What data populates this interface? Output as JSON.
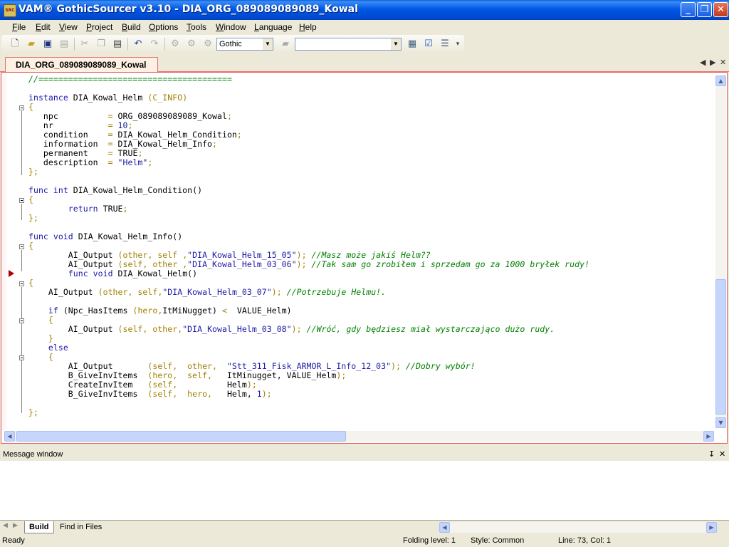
{
  "window": {
    "app_icon_text": "SRC",
    "title": "VAM® GothicSourcer v3.10 - DIA_ORG_089089089089_Kowal",
    "minimize_glyph": "_",
    "maximize_glyph": "❐",
    "close_glyph": "✕"
  },
  "menu": {
    "file": {
      "acc": "F",
      "rest": "ile"
    },
    "edit": {
      "acc": "E",
      "rest": "dit"
    },
    "view": {
      "acc": "V",
      "rest": "iew"
    },
    "project": {
      "acc": "P",
      "rest": "roject"
    },
    "build": {
      "acc": "B",
      "rest": "uild"
    },
    "options": {
      "acc": "O",
      "rest": "ptions"
    },
    "tools": {
      "acc": "T",
      "rest": "ools"
    },
    "window": {
      "acc": "W",
      "rest": "indow"
    },
    "language": {
      "acc": "L",
      "rest": "anguage"
    },
    "help": {
      "acc": "H",
      "rest": "elp"
    }
  },
  "toolbar": {
    "icons": [
      "new-file-icon",
      "open-folder-icon",
      "save-icon",
      "save-all-icon",
      "cut-icon",
      "copy-icon",
      "paste-icon",
      "undo-icon",
      "redo-icon",
      "compile-icon",
      "compile-all-icon",
      "run-icon",
      "folder-icon",
      "properties-icon",
      "check-icon",
      "list-icon"
    ],
    "language_combo": "Gothic",
    "second_combo": "",
    "combo_arrow": "▼"
  },
  "tabs": {
    "active_document": "DIA_ORG_089089089089_Kowal",
    "nav_left": "◀",
    "nav_right": "▶",
    "close": "✕"
  },
  "editor": {
    "lines": [
      [
        {
          "t": "//=======================================",
          "c": "com"
        }
      ],
      [
        {
          "t": "",
          "c": ""
        }
      ],
      [
        {
          "t": "instance ",
          "c": "kw"
        },
        {
          "t": "DIA_Kowal_Helm ",
          "c": ""
        },
        {
          "t": "(C_INFO)",
          "c": "var"
        }
      ],
      [
        {
          "t": "{",
          "c": "var"
        }
      ],
      [
        {
          "t": "   npc          ",
          "c": ""
        },
        {
          "t": "= ",
          "c": "var"
        },
        {
          "t": "ORG_089089089089_Kowal",
          "c": ""
        },
        {
          "t": ";",
          "c": "var"
        }
      ],
      [
        {
          "t": "   nr           ",
          "c": ""
        },
        {
          "t": "= ",
          "c": "var"
        },
        {
          "t": "10",
          "c": "num"
        },
        {
          "t": ";",
          "c": "var"
        }
      ],
      [
        {
          "t": "   condition    ",
          "c": ""
        },
        {
          "t": "= ",
          "c": "var"
        },
        {
          "t": "DIA_Kowal_Helm_Condition",
          "c": ""
        },
        {
          "t": ";",
          "c": "var"
        }
      ],
      [
        {
          "t": "   information  ",
          "c": ""
        },
        {
          "t": "= ",
          "c": "var"
        },
        {
          "t": "DIA_Kowal_Helm_Info",
          "c": ""
        },
        {
          "t": ";",
          "c": "var"
        }
      ],
      [
        {
          "t": "   permanent    ",
          "c": ""
        },
        {
          "t": "= ",
          "c": "var"
        },
        {
          "t": "TRUE",
          "c": ""
        },
        {
          "t": ";",
          "c": "var"
        }
      ],
      [
        {
          "t": "   description  ",
          "c": ""
        },
        {
          "t": "= ",
          "c": "var"
        },
        {
          "t": "\"Helm\"",
          "c": "str"
        },
        {
          "t": ";",
          "c": "var"
        }
      ],
      [
        {
          "t": "};",
          "c": "var"
        }
      ],
      [
        {
          "t": "",
          "c": ""
        }
      ],
      [
        {
          "t": "func int ",
          "c": "kw"
        },
        {
          "t": "DIA_Kowal_Helm_Condition()",
          "c": ""
        }
      ],
      [
        {
          "t": "{",
          "c": "var"
        }
      ],
      [
        {
          "t": "        ",
          "c": ""
        },
        {
          "t": "return ",
          "c": "kw"
        },
        {
          "t": "TRUE",
          "c": ""
        },
        {
          "t": ";",
          "c": "var"
        }
      ],
      [
        {
          "t": "};",
          "c": "var"
        }
      ],
      [
        {
          "t": "",
          "c": ""
        }
      ],
      [
        {
          "t": "func void ",
          "c": "kw"
        },
        {
          "t": "DIA_Kowal_Helm_Info()",
          "c": ""
        }
      ],
      [
        {
          "t": "{",
          "c": "var"
        }
      ],
      [
        {
          "t": "        AI_Output ",
          "c": ""
        },
        {
          "t": "(other, self ,",
          "c": "var"
        },
        {
          "t": "\"DIA_Kowal_Helm_15_05\"",
          "c": "str"
        },
        {
          "t": "); ",
          "c": "var"
        },
        {
          "t": "//Masz może jakiś Helm??",
          "c": "com"
        }
      ],
      [
        {
          "t": "        AI_Output ",
          "c": ""
        },
        {
          "t": "(self, other ,",
          "c": "var"
        },
        {
          "t": "\"DIA_Kowal_Helm_03_06\"",
          "c": "str"
        },
        {
          "t": "); ",
          "c": "var"
        },
        {
          "t": "//Tak sam go zrobiłem i sprzedam go za 1000 bryłek rudy!",
          "c": "com"
        }
      ],
      [
        {
          "t": "        ",
          "c": ""
        },
        {
          "t": "func void ",
          "c": "kw"
        },
        {
          "t": "DIA_Kowal_Helm()",
          "c": ""
        }
      ],
      [
        {
          "t": "{",
          "c": "var"
        }
      ],
      [
        {
          "t": "    AI_Output ",
          "c": ""
        },
        {
          "t": "(other, self,",
          "c": "var"
        },
        {
          "t": "\"DIA_Kowal_Helm_03_07\"",
          "c": "str"
        },
        {
          "t": "); ",
          "c": "var"
        },
        {
          "t": "//Potrzebuje Helmu!.",
          "c": "com"
        }
      ],
      [
        {
          "t": "",
          "c": ""
        }
      ],
      [
        {
          "t": "    ",
          "c": ""
        },
        {
          "t": "if ",
          "c": "kw"
        },
        {
          "t": "(Npc_HasItems ",
          "c": ""
        },
        {
          "t": "(hero,",
          "c": "var"
        },
        {
          "t": "ItMiNugget) ",
          "c": ""
        },
        {
          "t": "< ",
          "c": "var"
        },
        {
          "t": " VALUE_Helm)",
          "c": ""
        }
      ],
      [
        {
          "t": "    {",
          "c": "var"
        }
      ],
      [
        {
          "t": "        AI_Output ",
          "c": ""
        },
        {
          "t": "(self, other,",
          "c": "var"
        },
        {
          "t": "\"DIA_Kowal_Helm_03_08\"",
          "c": "str"
        },
        {
          "t": "); ",
          "c": "var"
        },
        {
          "t": "//Wróć, gdy będziesz miał wystarczająco dużo rudy.",
          "c": "com"
        }
      ],
      [
        {
          "t": "    }",
          "c": "var"
        }
      ],
      [
        {
          "t": "    ",
          "c": ""
        },
        {
          "t": "else",
          "c": "kw"
        }
      ],
      [
        {
          "t": "    {",
          "c": "var"
        }
      ],
      [
        {
          "t": "        AI_Output       ",
          "c": ""
        },
        {
          "t": "(self,  other,  ",
          "c": "var"
        },
        {
          "t": "\"Stt_311_Fisk_ARMOR_L_Info_12_03\"",
          "c": "str"
        },
        {
          "t": "); ",
          "c": "var"
        },
        {
          "t": "//Dobry wybór!",
          "c": "com"
        }
      ],
      [
        {
          "t": "        B_GiveInvItems  ",
          "c": ""
        },
        {
          "t": "(hero,  self,   ",
          "c": "var"
        },
        {
          "t": "ItMinugget, VALUE_Helm",
          "c": ""
        },
        {
          "t": ");",
          "c": "var"
        }
      ],
      [
        {
          "t": "        CreateInvItem   ",
          "c": ""
        },
        {
          "t": "(self,          ",
          "c": "var"
        },
        {
          "t": "Helm",
          "c": ""
        },
        {
          "t": ");",
          "c": "var"
        }
      ],
      [
        {
          "t": "        B_GiveInvItems  ",
          "c": ""
        },
        {
          "t": "(self,  hero,   ",
          "c": "var"
        },
        {
          "t": "Helm, ",
          "c": ""
        },
        {
          "t": "1",
          "c": "num"
        },
        {
          "t": ");",
          "c": "var"
        }
      ],
      [
        {
          "t": "",
          "c": ""
        }
      ],
      [
        {
          "t": "};",
          "c": "var"
        }
      ]
    ],
    "scroll_up": "▲",
    "scroll_down": "▼",
    "scroll_left": "◀",
    "scroll_right": "▶"
  },
  "message_window": {
    "title": "Message window",
    "pin": "↧",
    "close": "✕",
    "tabs": [
      "Build",
      "Find in Files"
    ],
    "nav_left": "◀",
    "nav_right": "▶"
  },
  "status": {
    "text": "Ready",
    "folding": "Folding level: 1",
    "style": "Style: Common",
    "position": "Line: 73, Col: 1"
  }
}
